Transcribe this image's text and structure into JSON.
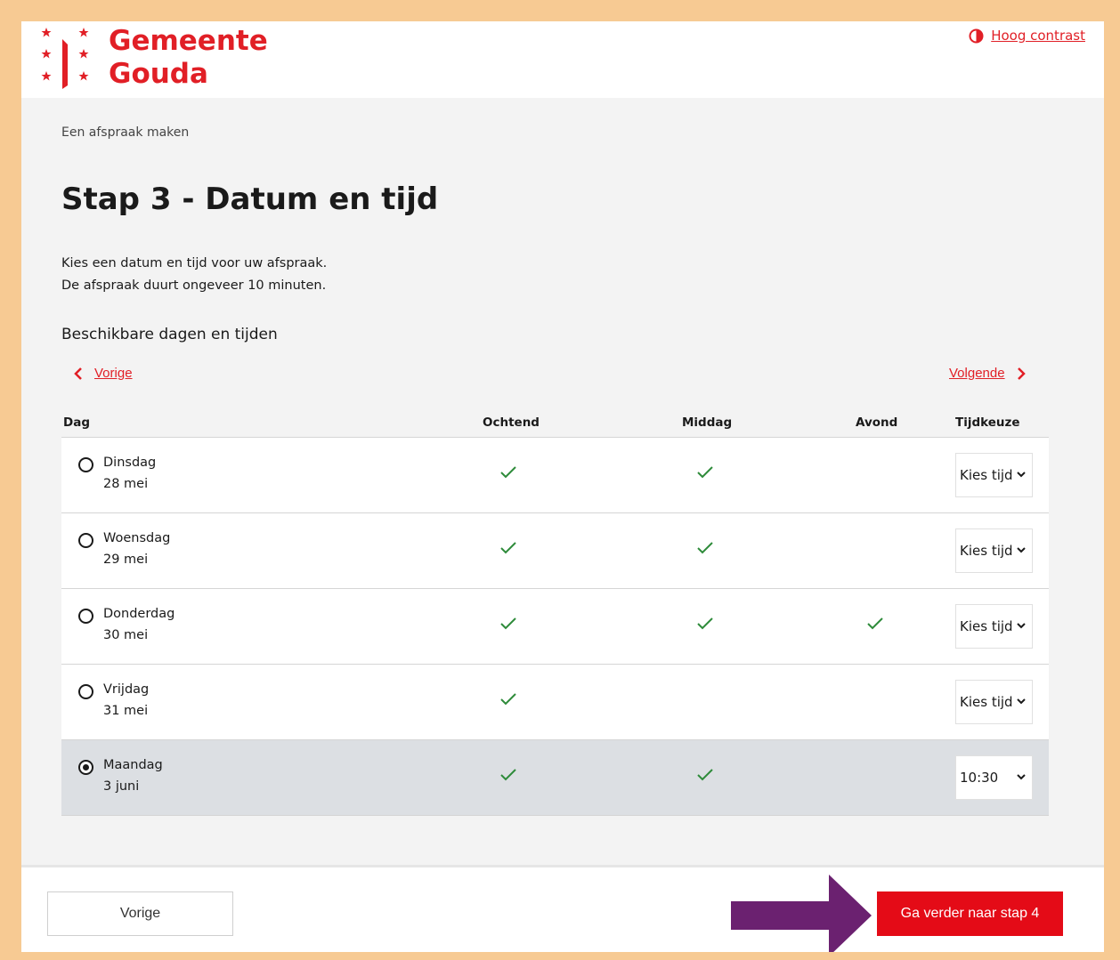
{
  "header": {
    "logo_line1": "Gemeente",
    "logo_line2": "Gouda",
    "contrast_link": "Hoog contrast"
  },
  "breadcrumb": "Een afspraak maken",
  "page_title": "Stap 3 - Datum en tijd",
  "intro": {
    "line1": "Kies een datum en tijd voor uw afspraak.",
    "line2": "De afspraak duurt ongeveer 10 minuten."
  },
  "section_title": "Beschikbare dagen en tijden",
  "nav": {
    "prev": "Vorige",
    "next": "Volgende"
  },
  "table": {
    "headers": {
      "day": "Dag",
      "morning": "Ochtend",
      "afternoon": "Middag",
      "evening": "Avond",
      "time": "Tijdkeuze"
    },
    "rows": [
      {
        "day": "Dinsdag",
        "date": "28 mei",
        "morning": true,
        "afternoon": true,
        "evening": false,
        "time": "Kies tijd",
        "selected": false
      },
      {
        "day": "Woensdag",
        "date": "29 mei",
        "morning": true,
        "afternoon": true,
        "evening": false,
        "time": "Kies tijd",
        "selected": false
      },
      {
        "day": "Donderdag",
        "date": "30 mei",
        "morning": true,
        "afternoon": true,
        "evening": true,
        "time": "Kies tijd",
        "selected": false
      },
      {
        "day": "Vrijdag",
        "date": "31 mei",
        "morning": true,
        "afternoon": false,
        "evening": false,
        "time": "Kies tijd",
        "selected": false
      },
      {
        "day": "Maandag",
        "date": "3 juni",
        "morning": true,
        "afternoon": true,
        "evening": false,
        "time": "10:30",
        "selected": true
      }
    ]
  },
  "footer": {
    "back_button": "Vorige",
    "next_button": "Ga verder naar stap 4"
  },
  "colors": {
    "brand_red": "#e11f26",
    "button_red": "#e40b17",
    "check_green": "#2e8b3a",
    "arrow_purple": "#6b2170",
    "frame_orange": "#f7ca93",
    "selected_row": "#dcdfe3"
  },
  "icons": {
    "logo": "gouda-stars-logo-icon",
    "contrast": "contrast-icon",
    "prev": "chevron-left-icon",
    "next": "chevron-right-icon",
    "check": "checkmark-icon",
    "select": "chevron-down-icon",
    "annotation": "arrow-right-icon"
  }
}
